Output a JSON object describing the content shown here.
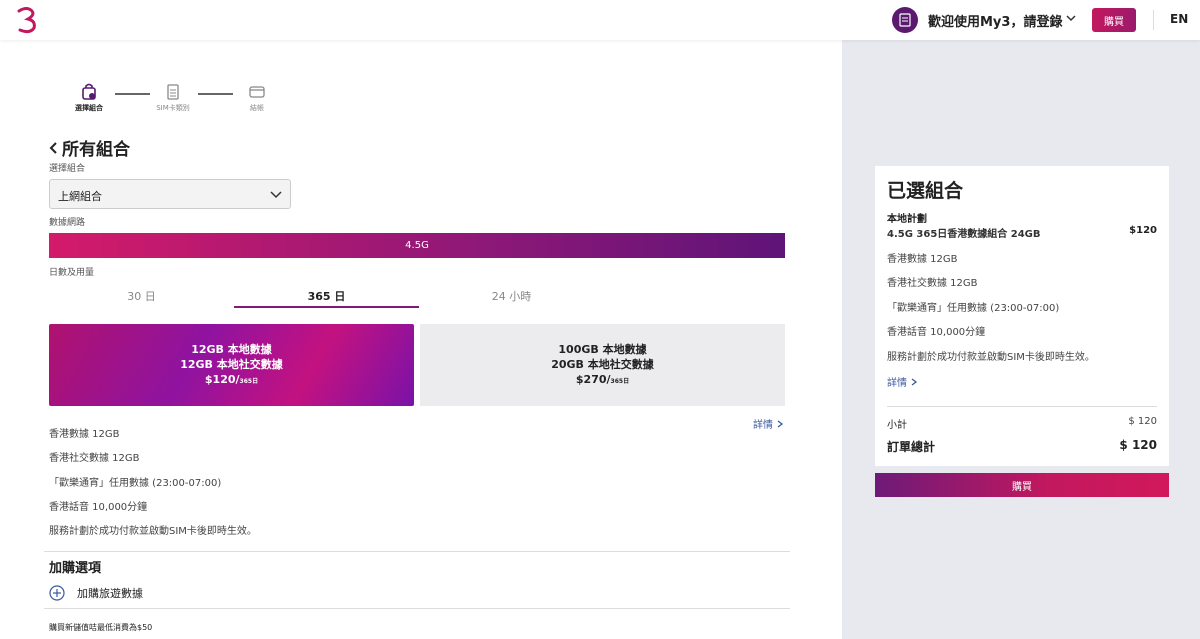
{
  "header": {
    "welcome": "歡迎使用My3，請登錄",
    "buy_label": "購買",
    "lang_label": "EN"
  },
  "steps": [
    {
      "label": "選擇組合",
      "icon": "bag-icon",
      "active": true
    },
    {
      "label": "SIM卡類別",
      "icon": "sim-icon",
      "active": false
    },
    {
      "label": "結帳",
      "icon": "card-icon",
      "active": false
    }
  ],
  "page": {
    "title": "所有組合",
    "choose_label": "選擇組合",
    "choose_value": "上網組合",
    "network_label": "數據網路",
    "network_value": "4.5G",
    "days_label": "日數及用量"
  },
  "tabs": [
    "30 日",
    "365 日",
    "24 小時"
  ],
  "plans": [
    {
      "line1": "12GB 本地數據",
      "line2": "12GB 本地社交數據",
      "price": "$120/",
      "period": "365日"
    },
    {
      "line1": "100GB 本地數據",
      "line2": "20GB 本地社交數據",
      "price": "$270/",
      "period": "365日"
    }
  ],
  "details_label": "詳情",
  "features": [
    "香港數據 12GB",
    "香港社交數據 12GB",
    "「歡樂通宵」任用數據 (23:00-07:00)",
    "香港話音 10,000分鐘",
    "服務計劃於成功付款並啟動SIM卡後即時生效。"
  ],
  "addons": {
    "title": "加購選項",
    "item": "加購旅遊數據"
  },
  "footer_note": "購買新儲值咭最低消費為$50",
  "summary": {
    "title": "已選組合",
    "plan_type": "本地計劃",
    "plan_name": "4.5G 365日香港數據組合 24GB",
    "plan_price": "$120",
    "features": [
      "香港數據 12GB",
      "香港社交數據 12GB",
      "「歡樂通宵」任用數據 (23:00-07:00)",
      "香港話音 10,000分鐘",
      "服務計劃於成功付款並啟動SIM卡後即時生效。"
    ],
    "details": "詳情",
    "subtotal_label": "小計",
    "subtotal_value": "$ 120",
    "total_label": "訂單總計",
    "total_value": "$ 120",
    "buy_label": "購買"
  },
  "colors": {
    "brand": "#c3185e",
    "purple": "#7d1a7a",
    "link": "#3a5aa0"
  }
}
